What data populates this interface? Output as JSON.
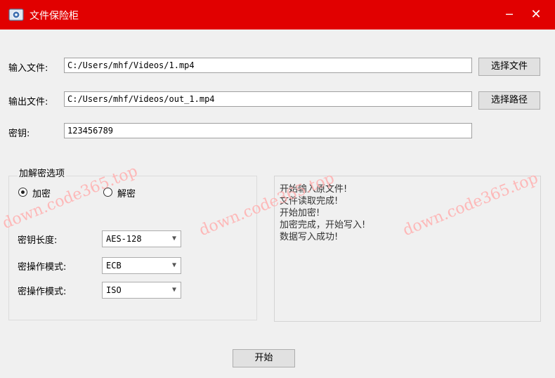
{
  "window": {
    "title": "文件保险柜",
    "minimize_glyph": "─",
    "close_glyph": "✕"
  },
  "form": {
    "input_label": "输入文件:",
    "input_value": "C:/Users/mhf/Videos/1.mp4",
    "choose_file_label": "选择文件",
    "output_label": "输出文件:",
    "output_value": "C:/Users/mhf/Videos/out_1.mp4",
    "choose_path_label": "选择路径",
    "key_label": "密钥:",
    "key_value": "123456789"
  },
  "options": {
    "group_title": "加解密选项",
    "encrypt_label": "加密",
    "decrypt_label": "解密",
    "selected": "encrypt",
    "key_length_label": "密钥长度:",
    "key_length_value": "AES-128",
    "mode_label": "密操作模式:",
    "mode_value": "ECB",
    "padding_label": "密操作模式:",
    "padding_value": "ISO"
  },
  "log": {
    "lines": [
      "开始输入原文件!",
      "文件读取完成!",
      "开始加密!",
      "加密完成，开始写入!",
      "数据写入成功!"
    ]
  },
  "start_button_label": "开始",
  "watermark_text": "down.code365.top",
  "colors": {
    "titlebar": "#e10000",
    "watermark": "#ffb3b3"
  }
}
